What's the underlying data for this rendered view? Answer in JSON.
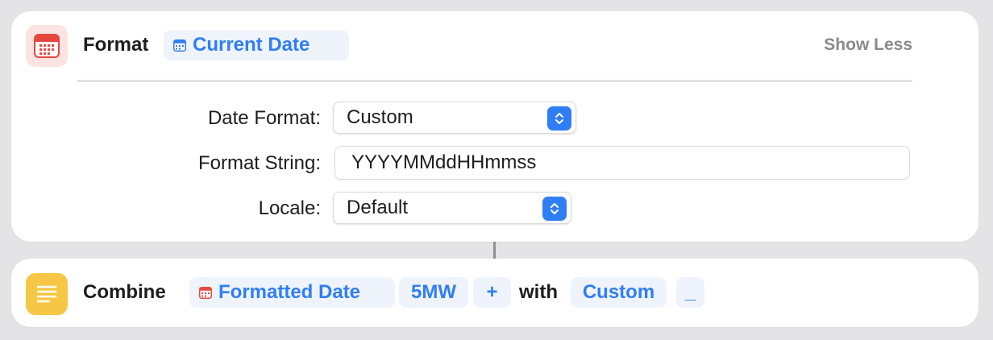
{
  "colors": {
    "accent": "#2f7ef5",
    "token_bg": "#eef3fc",
    "calendar_red": "#e5483e",
    "notes_yellow": "#f6c744"
  },
  "format_action": {
    "icon": "calendar-icon",
    "title": "Format",
    "input_token": {
      "icon": "calendar-icon",
      "label": "Current Date"
    },
    "toggle_label": "Show Less",
    "fields": {
      "date_format": {
        "label": "Date Format:",
        "value": "Custom"
      },
      "format_string": {
        "label": "Format String:",
        "value": "YYYYMMddHHmmss"
      },
      "locale": {
        "label": "Locale:",
        "value": "Default"
      }
    }
  },
  "combine_action": {
    "icon": "text-lines-icon",
    "title": "Combine",
    "input_token": {
      "icon": "calendar-icon",
      "label": "Formatted Date"
    },
    "tokens": [
      "5MW",
      "+"
    ],
    "with_label": "with",
    "separator_token": "Custom",
    "custom_value": "_"
  }
}
